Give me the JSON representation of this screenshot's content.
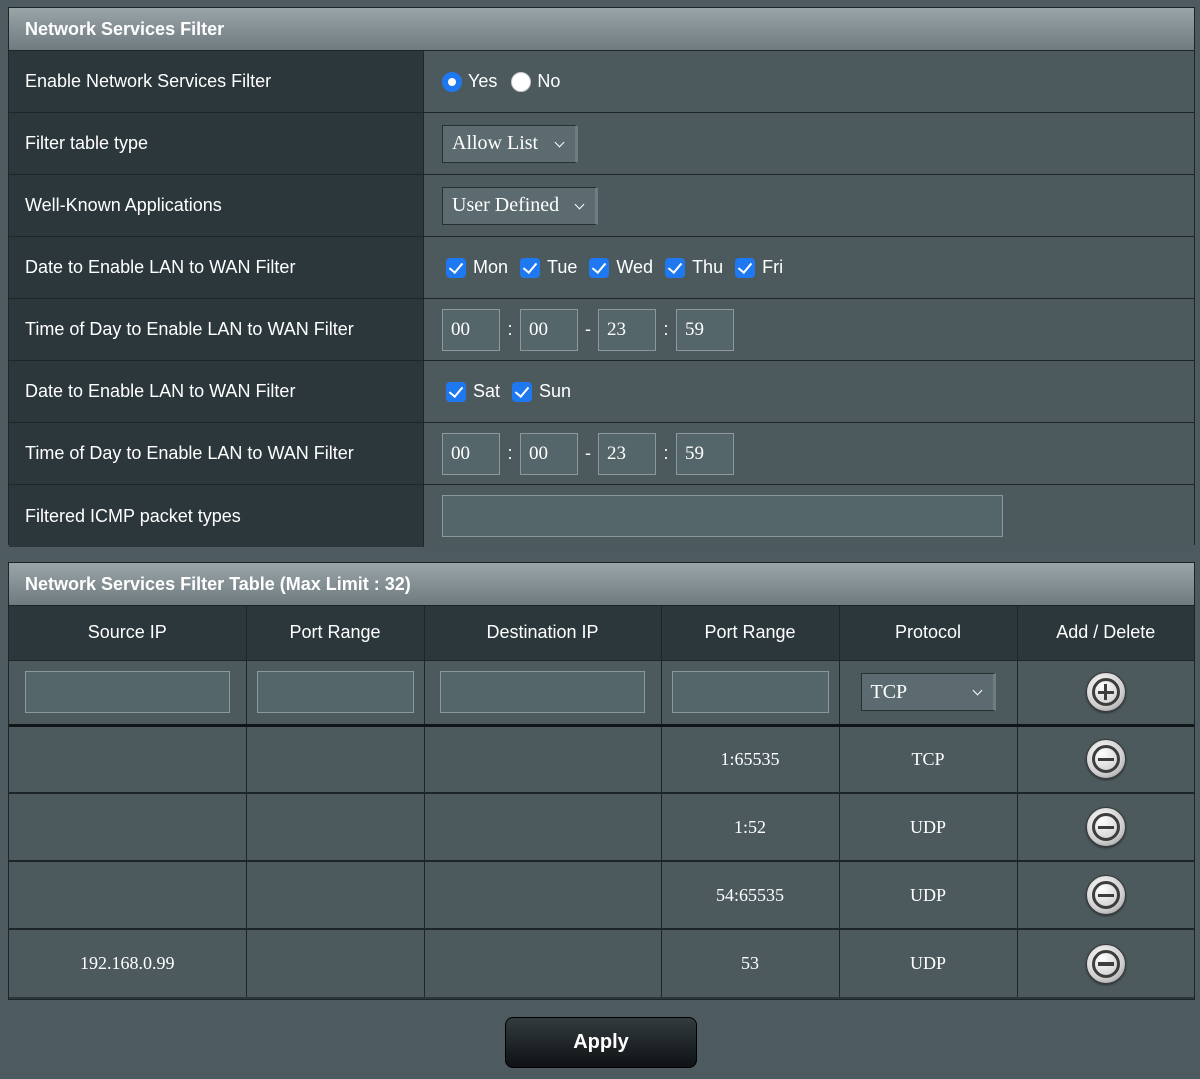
{
  "filter_section": {
    "title": "Network Services Filter",
    "enable_label": "Enable Network Services Filter",
    "enable_yes": "Yes",
    "enable_no": "No",
    "enable_value": "Yes",
    "table_type_label": "Filter table type",
    "table_type_value": "Allow List",
    "apps_label": "Well-Known Applications",
    "apps_value": "User Defined",
    "weekday_label": "Date to Enable LAN to WAN Filter",
    "weekdays": [
      "Mon",
      "Tue",
      "Wed",
      "Thu",
      "Fri"
    ],
    "weekday_time_label": "Time of Day to Enable LAN to WAN Filter",
    "weekday_time": [
      "00",
      "00",
      "23",
      "59"
    ],
    "weekend_label": "Date to Enable LAN to WAN Filter",
    "weekend_days": [
      "Sat",
      "Sun"
    ],
    "weekend_time_label": "Time of Day to Enable LAN to WAN Filter",
    "weekend_time": [
      "00",
      "00",
      "23",
      "59"
    ],
    "icmp_label": "Filtered ICMP packet types",
    "icmp_value": ""
  },
  "rules_table": {
    "title": "Network Services Filter Table (Max Limit : 32)",
    "columns": [
      "Source IP",
      "Port Range",
      "Destination IP",
      "Port Range",
      "Protocol",
      "Add / Delete"
    ],
    "new_protocol": "TCP",
    "rows": [
      {
        "source_ip": "",
        "src_port": "",
        "dest_ip": "",
        "dest_port": "1:65535",
        "protocol": "TCP"
      },
      {
        "source_ip": "",
        "src_port": "",
        "dest_ip": "",
        "dest_port": "1:52",
        "protocol": "UDP"
      },
      {
        "source_ip": "",
        "src_port": "",
        "dest_ip": "",
        "dest_port": "54:65535",
        "protocol": "UDP"
      },
      {
        "source_ip": "192.168.0.99",
        "src_port": "",
        "dest_ip": "",
        "dest_port": "53",
        "protocol": "UDP"
      }
    ]
  },
  "apply_label": "Apply",
  "icons": {
    "add": "plus-circle-icon",
    "delete": "minus-circle-icon",
    "dropdown": "chevron-down-icon"
  },
  "colors": {
    "checkbox": "#1e78f0",
    "cell_bg": "#4c5a5e",
    "label_bg": "#2b373b"
  }
}
